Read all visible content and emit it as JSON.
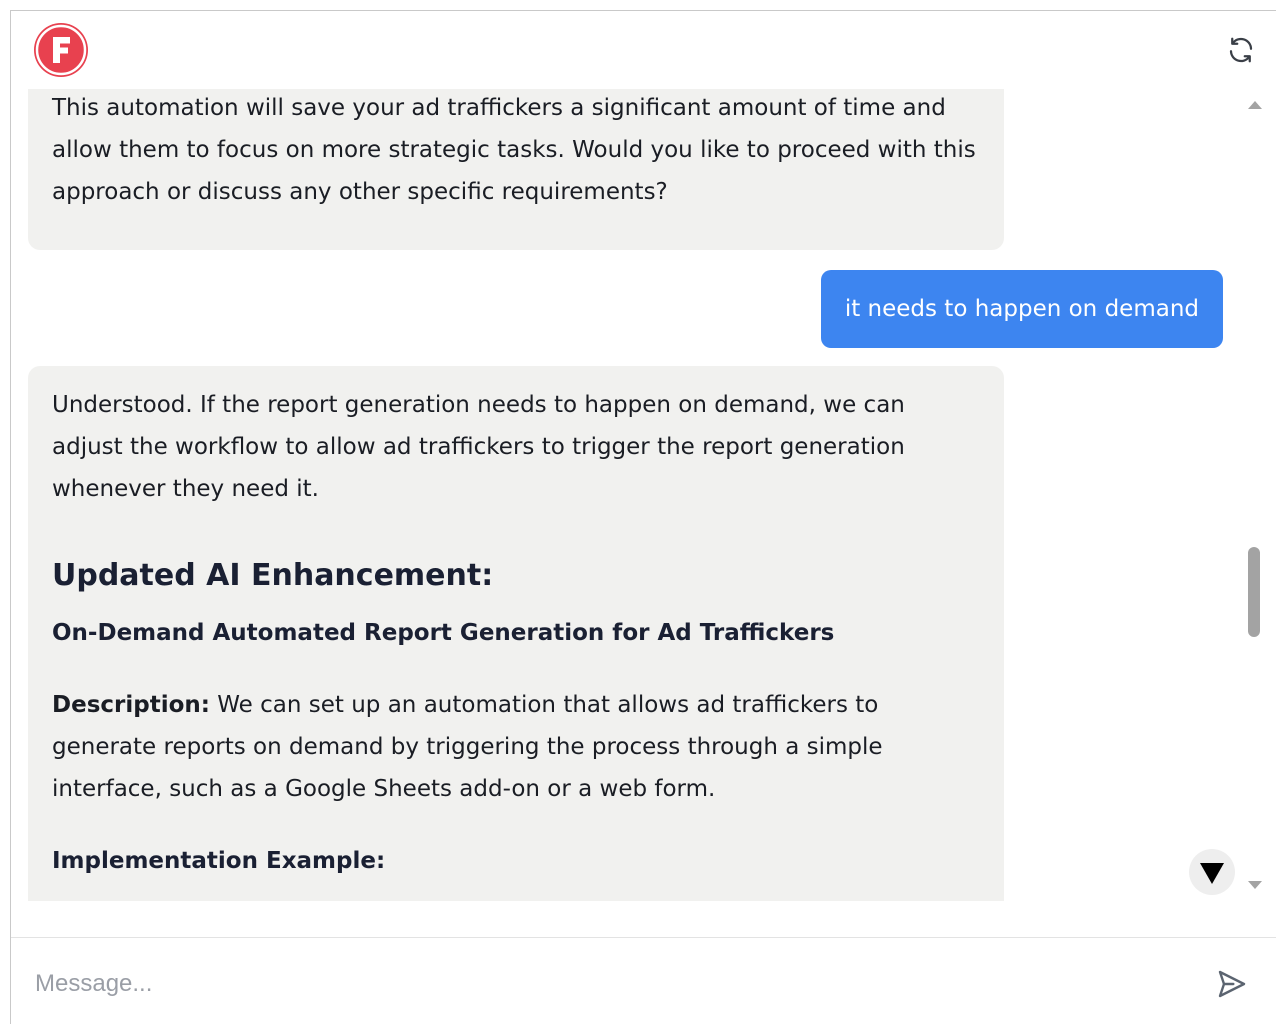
{
  "header": {
    "logo_letter": "F",
    "logo_color": "#e8414f",
    "refresh_icon": "refresh-icon"
  },
  "messages": {
    "bot_1": {
      "text": "This automation will save your ad traffickers a significant amount of time and allow them to focus on more strategic tasks. Would you like to proceed with this approach or discuss any other specific requirements?"
    },
    "user_1": {
      "text": "it needs to happen on demand"
    },
    "bot_2": {
      "intro": "Understood. If the report generation needs to happen on demand, we can adjust the workflow to allow ad traffickers to trigger the report generation whenever they need it.",
      "heading": "Updated AI Enhancement:",
      "subheading": "On-Demand Automated Report Generation for Ad Traffickers",
      "description_label": "Description:",
      "description_text": " We can set up an automation that allows ad traffickers to generate reports on demand by triggering the process through a simple interface, such as a Google Sheets add-on or a web form.",
      "implementation_label": "Implementation Example:"
    }
  },
  "colors": {
    "user_bubble": "#3d85f0",
    "bot_bubble": "#f1f1ef"
  },
  "composer": {
    "placeholder": "Message...",
    "value": "",
    "send_icon": "send-icon"
  },
  "scroll": {
    "jump_icon": "arrow-down-icon"
  }
}
